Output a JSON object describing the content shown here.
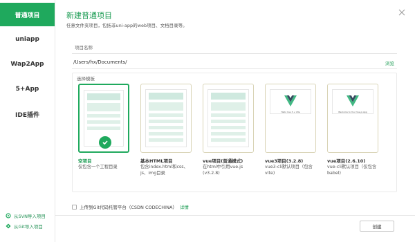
{
  "sidebar": {
    "items": [
      {
        "label": "普通项目",
        "active": true
      },
      {
        "label": "uniapp"
      },
      {
        "label": "Wap2App"
      },
      {
        "label": "5+App"
      },
      {
        "label": "IDE插件"
      }
    ],
    "links": [
      {
        "label": "从SVN导入项目",
        "icon": "svn-import-icon"
      },
      {
        "label": "从Git导入项目",
        "icon": "git-import-icon"
      }
    ]
  },
  "header": {
    "title": "新建普通项目",
    "subtitle": "任意文件夹项目，包括非uni-app的web项目、文档目录等。"
  },
  "form": {
    "name_placeholder": "项目名称",
    "path_value": "/Users/hx/Documents/",
    "browse_label": "浏览",
    "template_legend": "选择模板"
  },
  "templates": [
    {
      "name": "空项目",
      "desc": "仅包含一个工程目录",
      "selected": true
    },
    {
      "name": "基本HTML项目",
      "desc": "包含index.html和css、js、img目录"
    },
    {
      "name": "vue项目(普通模式)",
      "desc": "在html中引用vue.js (v3.2.8)"
    },
    {
      "name": "vue3项目(3.2.8)",
      "desc": "vue3-cli默认项目（包含vite)"
    },
    {
      "name": "vue项目(2.6.10)",
      "desc": "vue-cli默认项目（仅包含babel)"
    }
  ],
  "vue_banner": {
    "headline3": "Hello Vue 3 + Vite",
    "headline2": "Welcome to Your Vue.js App"
  },
  "git": {
    "label": "上传到Git代码托管平台（CSDN CODECHINA）",
    "link": "详情"
  },
  "footer": {
    "create_label": "创建"
  },
  "colors": {
    "accent": "#1fa95d",
    "card_border": "#d9d4b6",
    "placeholder_fill": "#cfe9df"
  }
}
